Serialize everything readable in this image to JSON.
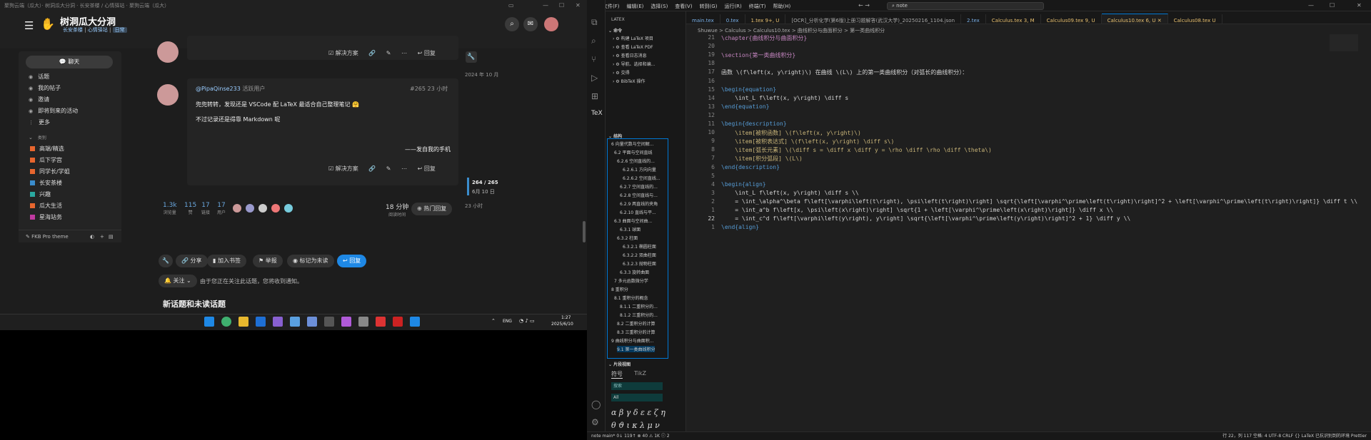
{
  "forum": {
    "window_title": "聚狗云端（瓜大）· 树洞瓜大分洞 · 长安茶楼 / 心情驿站 · 聚狗云端（瓜大）",
    "site_title": "树洞瓜大分洞",
    "subtitle_a": "长安茶楼",
    "subtitle_b": "心情驿站",
    "subtitle_badge": "日常",
    "chat_label": "💬 聊天",
    "nav": [
      "话题",
      "我的帖子",
      "邀请",
      "即将到来的活动",
      "更多"
    ],
    "categories_header": "类别",
    "categories": [
      {
        "name": "高端/精选",
        "color": "#e8662e"
      },
      {
        "name": "瓜下学宫",
        "color": "#e8662e"
      },
      {
        "name": "同学长/学姐",
        "color": "#e8662e"
      },
      {
        "name": "长安茶楼",
        "color": "#3a8ccc"
      },
      {
        "name": "兴趣",
        "color": "#2aa8a0"
      },
      {
        "name": "瓜大生活",
        "color": "#e8662e"
      },
      {
        "name": "星海站务",
        "color": "#c03aa0"
      }
    ],
    "theme_label": "FKB Pro theme",
    "post1_actions": [
      "解决方案",
      "回复"
    ],
    "post2_user": "@PipaQinse233",
    "post2_role": "活跃用户",
    "post2_num": "#265",
    "post2_time": "23 小时",
    "post2_line1": "兜兜转转，发现还是 VSCode 配 LaTeX 最适合自己整理笔记 🤗",
    "post2_line2": "不过记录还是得靠 Markdown 呢",
    "post2_sig": "——发自我的手机",
    "post2_actions": [
      "解决方案",
      "回复"
    ],
    "timeline_date": "2024 年 10 月",
    "timeline_pos": "264 / 265",
    "timeline_posdate": "6月 10 日",
    "timeline_ago": "23 小时",
    "stats": [
      {
        "v": "1.3k",
        "l": "浏览量"
      },
      {
        "v": "115",
        "l": "赞"
      },
      {
        "v": "17",
        "l": "链接"
      },
      {
        "v": "17",
        "l": "用户"
      }
    ],
    "duration": "18 分钟",
    "duration_label": "阅读时间",
    "hot_reply": "热门回复",
    "bottom_actions": [
      "分享",
      "加入书签",
      "举报",
      "标记为未读"
    ],
    "reply_btn": "回复",
    "follow_btn": "关注",
    "follow_note": "由于您正在关注此话题，您将收到通知。",
    "next_heading": "新话题和未读话题",
    "clock_time": "1:27",
    "clock_date": "2025/6/10",
    "ime": "ENG"
  },
  "vscode": {
    "menu": [
      "文件(F)",
      "编辑(E)",
      "选择(S)",
      "查看(V)",
      "转到(G)",
      "运行(R)",
      "终端(T)",
      "帮助(H)"
    ],
    "search": "note",
    "explorer_title": "LATEX",
    "cmd_header": "命令",
    "cmds": [
      "构建 LaTeX 项目",
      "查看 LaTeX PDF",
      "查看日志消息",
      "导航、选择和编...",
      "交得",
      "BibTeX 操作"
    ],
    "outline_header": "结构",
    "outline": [
      "6 向量代数与空间解...",
      "6.2 平面与空间直线",
      "6.2.6 空间直线的...",
      "6.2.6.1 方向向量",
      "6.2.6.2 空间直线...",
      "6.2.7 空间直线的...",
      "6.2.8 空间直线与...",
      "6.2.9 两直线的夹角",
      "6.2.10 直线与平...",
      "6.3 曲面与空间曲...",
      "6.3.1 球面",
      "6.3.2 柱面",
      "6.3.2.1 椭圆柱面",
      "6.3.2.2 双曲柱面",
      "6.3.2.3 抛物柱面",
      "6.3.3 旋转曲面",
      "7 多元函数微分学",
      "8 重积分",
      "8.1 重积分的概念",
      "8.1.1 二重积分的...",
      "8.1.2 三重积分的...",
      "8.2 二重积分的计算",
      "8.3 三重积分的计算",
      "9 曲线积分与曲面积...",
      "9.1 第一类曲线积分"
    ],
    "snippet_header": "片段视图",
    "snippet_tabs": [
      "符号",
      "TikZ"
    ],
    "snippet_search": "搜索",
    "snippet_all": "All",
    "greek_row1": "α β γ δ ε ε ζ η",
    "greek_row2": "θ ϑ ι κ λ μ ν",
    "tabs": [
      "main.tex",
      "0.tex",
      "1.tex 9+, U",
      "[OCR]_分析化学(第6版)上册习题解答(武汉大学)_20250216_1104.json",
      "2.tex",
      "Calculus.tex 3, M",
      "Calculus09.tex 9, U",
      "Calculus10.tex 6, U",
      "Calculus08.tex U"
    ],
    "breadcrumb": "Shuwue > Calculus > Calculus10.tex > 曲线积分与曲面积分 > 第一类曲线积分",
    "lines": [
      {
        "n": "21",
        "t": "\\chapter{曲线积分与曲面积分}"
      },
      {
        "n": "20",
        "t": ""
      },
      {
        "n": "19",
        "t": "\\section{第一类曲线积分}"
      },
      {
        "n": "18",
        "t": ""
      },
      {
        "n": "17",
        "t": "函数 \\(f\\left(x, y\\right)\\) 在曲线 \\(L\\) 上的第一类曲线积分（对弧长的曲线积分）："
      },
      {
        "n": "16",
        "t": ""
      },
      {
        "n": "15",
        "t": "\\begin{equation}"
      },
      {
        "n": "14",
        "t": "    \\int_L f\\left(x, y\\right) \\diff s"
      },
      {
        "n": "13",
        "t": "\\end{equation}"
      },
      {
        "n": "12",
        "t": ""
      },
      {
        "n": "11",
        "t": "\\begin{description}"
      },
      {
        "n": "10",
        "t": "    \\item[被积函数] \\(f\\left(x, y\\right)\\)"
      },
      {
        "n": "9",
        "t": "    \\item[被积表达式] \\(f\\left(x, y\\right) \\diff s\\)"
      },
      {
        "n": "8",
        "t": "    \\item[弧长元素] \\(\\diff s = \\diff x \\diff y = \\rho \\diff \\rho \\diff \\theta\\)"
      },
      {
        "n": "7",
        "t": "    \\item[积分弧段] \\(L\\)"
      },
      {
        "n": "6",
        "t": "\\end{description}"
      },
      {
        "n": "5",
        "t": ""
      },
      {
        "n": "4",
        "t": "\\begin{align}"
      },
      {
        "n": "3",
        "t": "    \\int_L f\\left(x, y\\right) \\diff s \\\\"
      },
      {
        "n": "2",
        "t": "    = \\int_\\alpha^\\beta f\\left[\\varphi\\left(t\\right), \\psi\\left(t\\right)\\right] \\sqrt{\\left[\\varphi^\\prime\\left(t\\right)\\right]^2 + \\left[\\varphi^\\prime\\left(t\\right)\\right]} \\diff t \\\\"
      },
      {
        "n": "1",
        "t": "    = \\int_a^b f\\left[x, \\psi\\left(x\\right)\\right] \\sqrt{1 + \\left[\\varphi^\\prime\\left(x\\right)\\right]} \\diff x \\\\"
      },
      {
        "n": "22",
        "t": "    = \\int_c^d f\\left[\\varphi\\left(y\\right), y\\right] \\sqrt{\\left[\\varphi^\\prime\\left(y\\right)\\right]^2 + 1} \\diff y \\\\"
      },
      {
        "n": "1",
        "t": "\\end{align}"
      }
    ],
    "status_left": "note  main*  0↓ 119↑  ⊗ 40 ⚠ 1K ⓘ 2",
    "status_right": "行 22，列 117   空格: 4   UTF-8   CRLF   {} LaTeX   已抗识别到的环境   Prettier"
  }
}
